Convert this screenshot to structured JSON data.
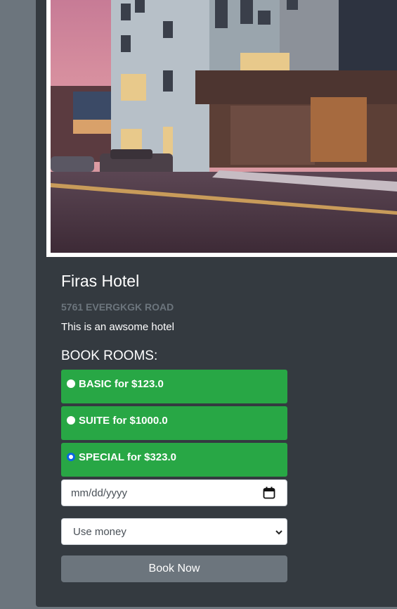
{
  "hotel": {
    "name": "Firas Hotel",
    "address": "5761 EVERGKGK ROAD",
    "description": "This is an awsome hotel"
  },
  "booking": {
    "heading": "BOOK ROOMS:",
    "rooms": [
      {
        "label": "BASIC for $123.0",
        "selected": false
      },
      {
        "label": "SUITE for $1000.0",
        "selected": false
      },
      {
        "label": "SPECIAL for $323.0",
        "selected": true
      }
    ],
    "date_placeholder": "mm/dd/yyyy",
    "payment_selected": "Use money",
    "submit_label": "Book Now"
  },
  "colors": {
    "room_option_bg": "#28a745",
    "card_bg": "#343a40",
    "page_bg": "#6c757d",
    "button_bg": "#6c757d"
  },
  "icons": {
    "date": "calendar-icon",
    "select": "chevron-down-icon"
  }
}
